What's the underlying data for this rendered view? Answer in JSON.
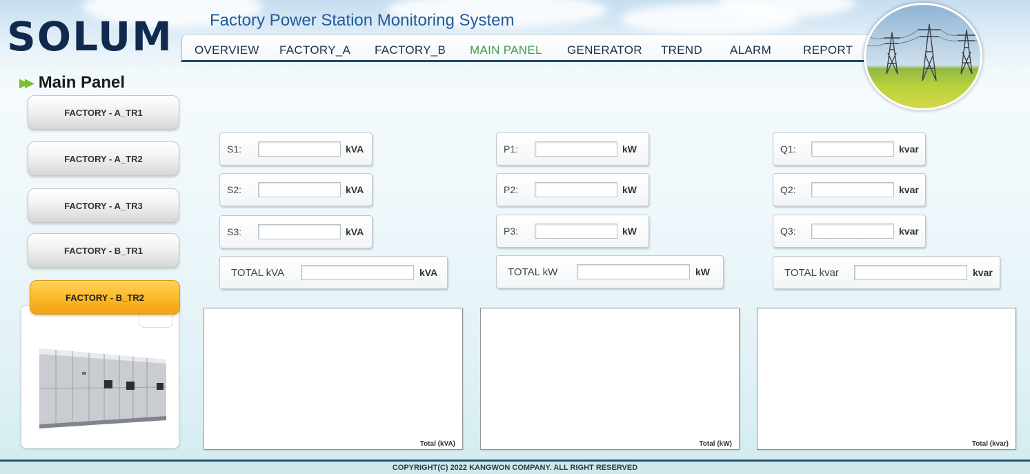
{
  "brand": {
    "logo": "SOLUM"
  },
  "header": {
    "title": "Factory Power Station Monitoring System"
  },
  "nav": [
    {
      "label": "OVERVIEW",
      "active": false
    },
    {
      "label": "FACTORY_A",
      "active": false
    },
    {
      "label": "FACTORY_B",
      "active": false
    },
    {
      "label": "MAIN PANEL",
      "active": true
    },
    {
      "label": "GENERATOR",
      "active": false
    },
    {
      "label": "TREND",
      "active": false
    },
    {
      "label": "ALARM",
      "active": false
    },
    {
      "label": "REPORT",
      "active": false
    }
  ],
  "section_title": "Main Panel",
  "transformers": [
    {
      "label": "FACTORY - A_TR1",
      "selected": false
    },
    {
      "label": "FACTORY - A_TR2",
      "selected": false
    },
    {
      "label": "FACTORY - A_TR3",
      "selected": false
    },
    {
      "label": "FACTORY - B_TR1",
      "selected": false
    },
    {
      "label": "FACTORY - B_TR2",
      "selected": true
    }
  ],
  "readings": {
    "apparent": {
      "rows": [
        {
          "label": "S1:",
          "value": "",
          "unit": "kVA"
        },
        {
          "label": "S2:",
          "value": "",
          "unit": "kVA"
        },
        {
          "label": "S3:",
          "value": "",
          "unit": "kVA"
        }
      ],
      "total": {
        "label": "TOTAL kVA",
        "value": "",
        "unit": "kVA"
      },
      "chart_caption": "Total (kVA)"
    },
    "active": {
      "rows": [
        {
          "label": "P1:",
          "value": "",
          "unit": "kW"
        },
        {
          "label": "P2:",
          "value": "",
          "unit": "kW"
        },
        {
          "label": "P3:",
          "value": "",
          "unit": "kW"
        }
      ],
      "total": {
        "label": "TOTAL kW",
        "value": "",
        "unit": "kW"
      },
      "chart_caption": "Total (kW)"
    },
    "reactive": {
      "rows": [
        {
          "label": "Q1:",
          "value": "",
          "unit": "kvar"
        },
        {
          "label": "Q2:",
          "value": "",
          "unit": "kvar"
        },
        {
          "label": "Q3:",
          "value": "",
          "unit": "kvar"
        }
      ],
      "total": {
        "label": "TOTAL kvar",
        "value": "",
        "unit": "kvar"
      },
      "chart_caption": "Total (kvar)"
    }
  },
  "colors": {
    "nav_active": "#3f9a4c",
    "nav_border": "#20486c",
    "selected_button": "#fbb823",
    "title_blue": "#1f5b98"
  },
  "footer": {
    "copyright": "COPYRIGHT(C) 2022 KANGWON COMPANY. ALL RIGHT RESERVED"
  }
}
